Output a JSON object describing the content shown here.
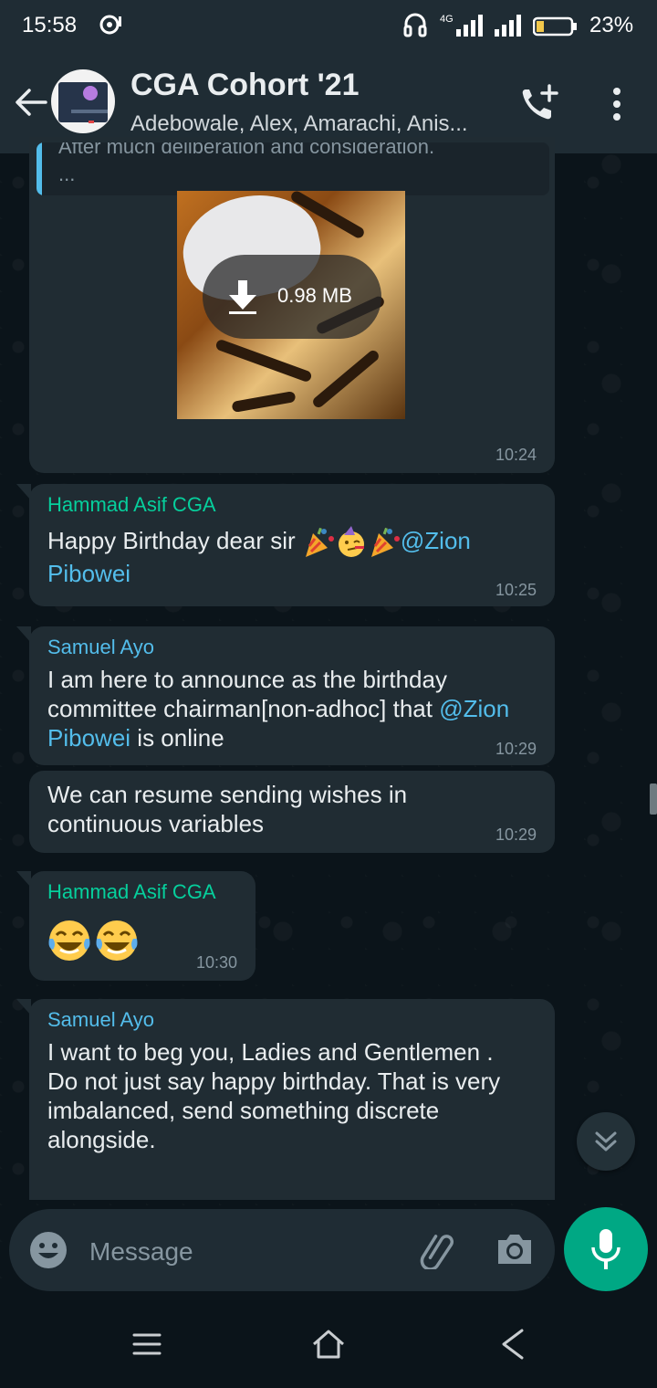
{
  "status_bar": {
    "time": "15:58",
    "network": "4G",
    "battery_percent": "23%",
    "battery_level": 0.23
  },
  "header": {
    "title": "CGA Cohort '21",
    "participants": "Adebowale, Alex, Amarachi, Anis...",
    "avatar_text": "CGA Cohort"
  },
  "messages": [
    {
      "quoted_text": "After much deliberation and consideration.",
      "quoted_ellipsis": "...",
      "media_size": "0.98 MB",
      "time": "10:24"
    },
    {
      "sender": "Hammad Asif CGA",
      "sender_color": "#06cf9c",
      "text": "Happy Birthday dear sir ",
      "emojis": [
        "party-popper",
        "partying-face",
        "party-popper"
      ],
      "mention_part1": "@Zion",
      "mention_part2": "Pibowei",
      "time": "10:25"
    },
    {
      "sender": "Samuel Ayo",
      "sender_color": "#53bdeb",
      "line1": "I am here to announce as the birthday",
      "line2_text": "committee chairman[non-adhoc] that ",
      "line2_mention": "@Zion",
      "line3_mention": "Pibowei",
      "line3_text": " is online",
      "time": "10:29"
    },
    {
      "line1": "We can resume sending wishes in",
      "line2": "continuous variables",
      "time": "10:29"
    },
    {
      "sender": "Hammad Asif CGA",
      "sender_color": "#06cf9c",
      "emojis": [
        "face-with-tears-of-joy",
        "face-with-tears-of-joy"
      ],
      "time": "10:30"
    },
    {
      "sender": "Samuel Ayo",
      "sender_color": "#53bdeb",
      "line1": "I want to beg you, Ladies and Gentlemen .",
      "line2": "Do not just say happy birthday. That is very",
      "line3": "imbalanced, send something discrete",
      "line4": "alongside."
    }
  ],
  "composer": {
    "placeholder": "Message"
  },
  "colors": {
    "accent": "#00a884",
    "bubble": "#202c33",
    "header": "#1f2c34",
    "mention": "#53bdeb"
  }
}
